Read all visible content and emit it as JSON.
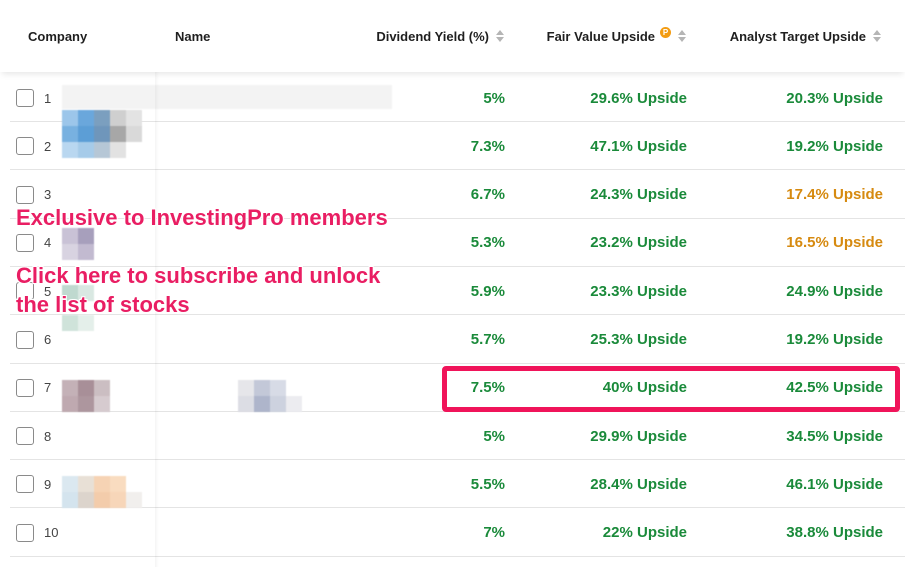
{
  "table": {
    "headers": {
      "company": "Company",
      "name": "Name",
      "dividend_yield": "Dividend Yield (%)",
      "fair_value_upside": "Fair Value Upside",
      "analyst_target_upside": "Analyst Target Upside"
    },
    "rows": [
      {
        "num": "1",
        "dividend_yield": "5%",
        "fair_value": "29.6% Upside",
        "analyst_target": "20.3% Upside",
        "at_color": "green"
      },
      {
        "num": "2",
        "dividend_yield": "7.3%",
        "fair_value": "47.1% Upside",
        "analyst_target": "19.2% Upside",
        "at_color": "green"
      },
      {
        "num": "3",
        "dividend_yield": "6.7%",
        "fair_value": "24.3% Upside",
        "analyst_target": "17.4% Upside",
        "at_color": "orange"
      },
      {
        "num": "4",
        "dividend_yield": "5.3%",
        "fair_value": "23.2% Upside",
        "analyst_target": "16.5% Upside",
        "at_color": "orange"
      },
      {
        "num": "5",
        "dividend_yield": "5.9%",
        "fair_value": "23.3% Upside",
        "analyst_target": "24.9% Upside",
        "at_color": "green"
      },
      {
        "num": "6",
        "dividend_yield": "5.7%",
        "fair_value": "25.3% Upside",
        "analyst_target": "19.2% Upside",
        "at_color": "green"
      },
      {
        "num": "7",
        "dividend_yield": "7.5%",
        "fair_value": "40% Upside",
        "analyst_target": "42.5% Upside",
        "at_color": "green"
      },
      {
        "num": "8",
        "dividend_yield": "5%",
        "fair_value": "29.9% Upside",
        "analyst_target": "34.5% Upside",
        "at_color": "green"
      },
      {
        "num": "9",
        "dividend_yield": "5.5%",
        "fair_value": "28.4% Upside",
        "analyst_target": "46.1% Upside",
        "at_color": "green"
      },
      {
        "num": "10",
        "dividend_yield": "7%",
        "fair_value": "22% Upside",
        "analyst_target": "38.8% Upside",
        "at_color": "green"
      }
    ]
  },
  "overlay": {
    "line1": "Exclusive to InvestingPro members",
    "line2a": "Click here to subscribe and unlock",
    "line2b": "the list of stocks"
  },
  "colors": {
    "green": "#1a8a3a",
    "orange": "#d68a10",
    "overlay": "#e91e63",
    "highlight": "#f0145a"
  },
  "icons": {
    "sort": "sort-icon",
    "pro_badge": "pro-badge-icon"
  }
}
